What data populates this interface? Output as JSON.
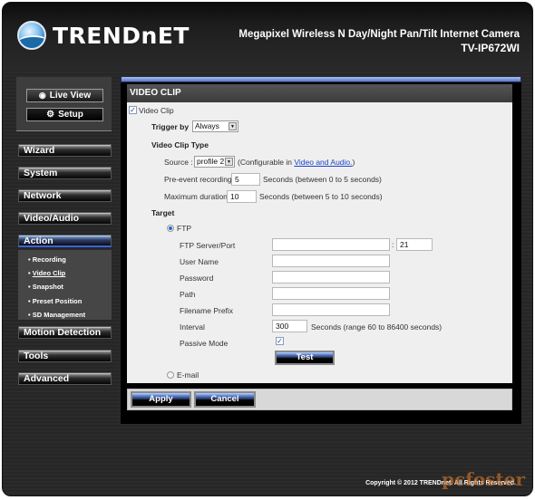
{
  "header": {
    "brand": "TRENDnET",
    "product_line": "Megapixel Wireless N Day/Night Pan/Tilt Internet Camera",
    "model": "TV-IP672WI"
  },
  "top_buttons": {
    "live_view": "Live View",
    "setup": "Setup"
  },
  "nav": {
    "items": [
      {
        "label": "Wizard"
      },
      {
        "label": "System"
      },
      {
        "label": "Network"
      },
      {
        "label": "Video/Audio"
      },
      {
        "label": "Action"
      },
      {
        "label": "Motion Detection"
      },
      {
        "label": "Tools"
      },
      {
        "label": "Advanced"
      }
    ],
    "action_submenu": [
      {
        "label": "Recording"
      },
      {
        "label": "Video Clip"
      },
      {
        "label": "Snapshot"
      },
      {
        "label": "Preset Position"
      },
      {
        "label": "SD Management"
      }
    ],
    "active": "Action",
    "current_sub": "Video Clip",
    "bullet": "•"
  },
  "panel": {
    "title": "VIDEO CLIP",
    "video_clip_enabled_label": "Video Clip",
    "video_clip_enabled": true,
    "trigger_by_label": "Trigger by",
    "trigger_by_value": "Always",
    "clip_type_heading": "Video Clip Type",
    "source_label": "Source :",
    "source_value": "profile 2",
    "source_note_prefix": "(Configurable in ",
    "source_note_link": "Video and Audio.",
    "source_note_suffix": ")",
    "pre_event_label": "Pre-event recording",
    "pre_event_value": "5",
    "pre_event_note": "Seconds  (between 0 to 5 seconds)",
    "max_duration_label": "Maximum duration",
    "max_duration_value": "10",
    "max_duration_note": "Seconds  (between 5 to 10 seconds)",
    "target_heading": "Target",
    "ftp_label": "FTP",
    "ftp_selected": true,
    "ftp_server_label": "FTP Server/Port",
    "ftp_server_value": "",
    "port_separator": ":",
    "ftp_port_value": "21",
    "user_name_label": "User Name",
    "user_name_value": "",
    "password_label": "Password",
    "password_value": "",
    "path_label": "Path",
    "path_value": "",
    "filename_prefix_label": "Filename Prefix",
    "filename_prefix_value": "",
    "interval_label": "Interval",
    "interval_value": "300",
    "interval_note": "Seconds  (range 60 to 86400 seconds)",
    "passive_mode_label": "Passive Mode",
    "passive_mode": true,
    "test_button": "Test",
    "email_label": "E-mail",
    "email_selected": false
  },
  "actions": {
    "apply": "Apply",
    "cancel": "Cancel"
  },
  "footer": {
    "copyright": "Copyright © 2012 TRENDnet. All Rights Reserved.",
    "watermark": "pcfoster"
  },
  "icons": {
    "checkmark": "✓",
    "dropdown_arrow": "▼",
    "eye": "👁",
    "gear": "⚙"
  },
  "colors": {
    "accent_blue": "#5876c8",
    "link": "#1a45c8",
    "content_bg": "#efefef"
  }
}
